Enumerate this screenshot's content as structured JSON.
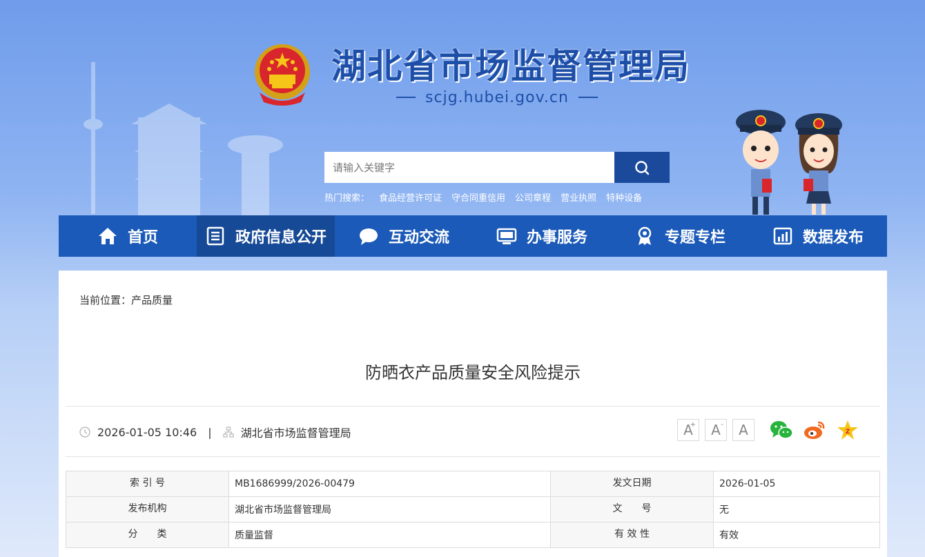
{
  "header": {
    "site_title": "湖北省市场监督管理局",
    "domain": "scjg.hubei.gov.cn"
  },
  "search": {
    "placeholder": "请输入关键字",
    "hot_label": "热门搜索：",
    "hot_items": [
      "食品经营许可证",
      "守合同重信用",
      "公司章程",
      "营业执照",
      "特种设备"
    ]
  },
  "nav": {
    "items": [
      {
        "label": "首页",
        "icon": "home-icon"
      },
      {
        "label": "政府信息公开",
        "icon": "document-icon",
        "active": true
      },
      {
        "label": "互动交流",
        "icon": "chat-icon"
      },
      {
        "label": "办事服务",
        "icon": "monitor-icon"
      },
      {
        "label": "专题专栏",
        "icon": "award-icon"
      },
      {
        "label": "数据发布",
        "icon": "chart-icon"
      }
    ]
  },
  "breadcrumb": "当前位置：产品质量",
  "article": {
    "title": "防晒衣产品质量安全风险提示",
    "datetime": "2026-01-05 10:46",
    "separator": "|",
    "source": "湖北省市场监督管理局"
  },
  "tools": {
    "font_large": "A",
    "font_medium": "A",
    "font_small": "A",
    "font_plus": "+",
    "font_minus": "-"
  },
  "info_table": {
    "index_label": "索 引 号",
    "index_value": "MB1686999/2026-00479",
    "date_label": "发文日期",
    "date_value": "2026-01-05",
    "org_label": "发布机构",
    "org_value": "湖北省市场监督管理局",
    "doc_label": "文　　号",
    "doc_value": "无",
    "category_label": "分　　类",
    "category_value": "质量监督",
    "validity_label": "有 效 性",
    "validity_value": "有效"
  },
  "colors": {
    "nav_bg": "#1b5ab8",
    "nav_active": "#174a96",
    "title_blue": "#1e4fa8",
    "search_btn": "#1b4a9c"
  }
}
